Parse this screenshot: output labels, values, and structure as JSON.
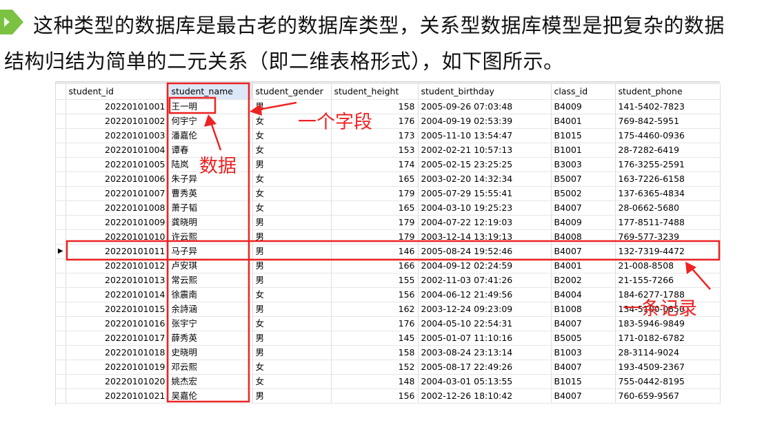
{
  "intro": {
    "line1": "这种类型的数据库是最古老的数据库类型，关系型数据库模型是把复杂的数据",
    "line2": "结构归结为简单的二元关系（即二维表格形式），如下图所示。"
  },
  "colors": {
    "bullet": "#7cc242",
    "annotation": "#ee2222",
    "selected_header": "#dce8f7"
  },
  "table": {
    "headers": [
      "student_id",
      "student_name",
      "student_gender",
      "student_height",
      "student_birthday",
      "class_id",
      "student_phone"
    ],
    "current_row_marker": "▶",
    "rows": [
      [
        "20220101001",
        "王一明",
        "男",
        "158",
        "2005-09-26 07:03:48",
        "B4009",
        "141-5402-7823"
      ],
      [
        "20220101002",
        "何宇宁",
        "女",
        "176",
        "2004-09-19 02:53:39",
        "B4001",
        "769-842-5951"
      ],
      [
        "20220101003",
        "潘嘉伦",
        "女",
        "173",
        "2005-11-10 13:54:47",
        "B1015",
        "175-4460-0936"
      ],
      [
        "20220101004",
        "谭春",
        "女",
        "153",
        "2002-02-21 10:57:13",
        "B1001",
        "28-7282-6419"
      ],
      [
        "20220101005",
        "陆岚",
        "男",
        "174",
        "2005-02-15 23:25:25",
        "B3003",
        "176-3255-2591"
      ],
      [
        "20220101006",
        "朱子异",
        "女",
        "165",
        "2003-02-20 14:32:34",
        "B5007",
        "163-7226-6158"
      ],
      [
        "20220101007",
        "曹秀英",
        "女",
        "179",
        "2005-07-29 15:55:41",
        "B5002",
        "137-6365-4834"
      ],
      [
        "20220101008",
        "萧子韬",
        "女",
        "165",
        "2004-03-10 19:25:23",
        "B4007",
        "28-0662-5680"
      ],
      [
        "20220101009",
        "龚晓明",
        "男",
        "179",
        "2004-07-22 12:19:03",
        "B4009",
        "177-8511-7488"
      ],
      [
        "20220101010",
        "许云熙",
        "男",
        "179",
        "2003-12-14 13:19:13",
        "B4008",
        "769-577-3239"
      ],
      [
        "20220101011",
        "马子异",
        "男",
        "146",
        "2005-08-24 19:52:46",
        "B4007",
        "132-7319-4472"
      ],
      [
        "20220101012",
        "卢安琪",
        "男",
        "166",
        "2004-09-12 02:24:59",
        "B4001",
        "21-008-8508"
      ],
      [
        "20220101013",
        "常云熙",
        "男",
        "155",
        "2002-11-03 07:41:26",
        "B2002",
        "21-155-7266"
      ],
      [
        "20220101014",
        "徐震南",
        "女",
        "156",
        "2004-06-12 21:49:56",
        "B4004",
        "184-6277-1788"
      ],
      [
        "20220101015",
        "余詩涵",
        "男",
        "162",
        "2003-12-24 09:23:09",
        "B1008",
        "134-5100-0850"
      ],
      [
        "20220101016",
        "张宇宁",
        "女",
        "176",
        "2004-05-10 22:54:31",
        "B4007",
        "183-5946-9849"
      ],
      [
        "20220101017",
        "薛秀英",
        "男",
        "145",
        "2005-01-07 11:10:16",
        "B5005",
        "171-0182-6782"
      ],
      [
        "20220101018",
        "史晓明",
        "男",
        "158",
        "2003-08-24 23:13:14",
        "B1003",
        "28-3114-9024"
      ],
      [
        "20220101019",
        "邓云熙",
        "女",
        "152",
        "2005-08-17 22:49:26",
        "B4007",
        "193-4509-2367"
      ],
      [
        "20220101020",
        "姚杰宏",
        "女",
        "148",
        "2004-03-01 05:13:55",
        "B1015",
        "755-0442-8195"
      ],
      [
        "20220101021",
        "吴嘉伦",
        "男",
        "156",
        "2002-12-26 18:10:42",
        "B4007",
        "760-659-9567"
      ]
    ]
  },
  "annotations": {
    "field": "一个字段",
    "data": "数据",
    "record": "一条记录"
  }
}
